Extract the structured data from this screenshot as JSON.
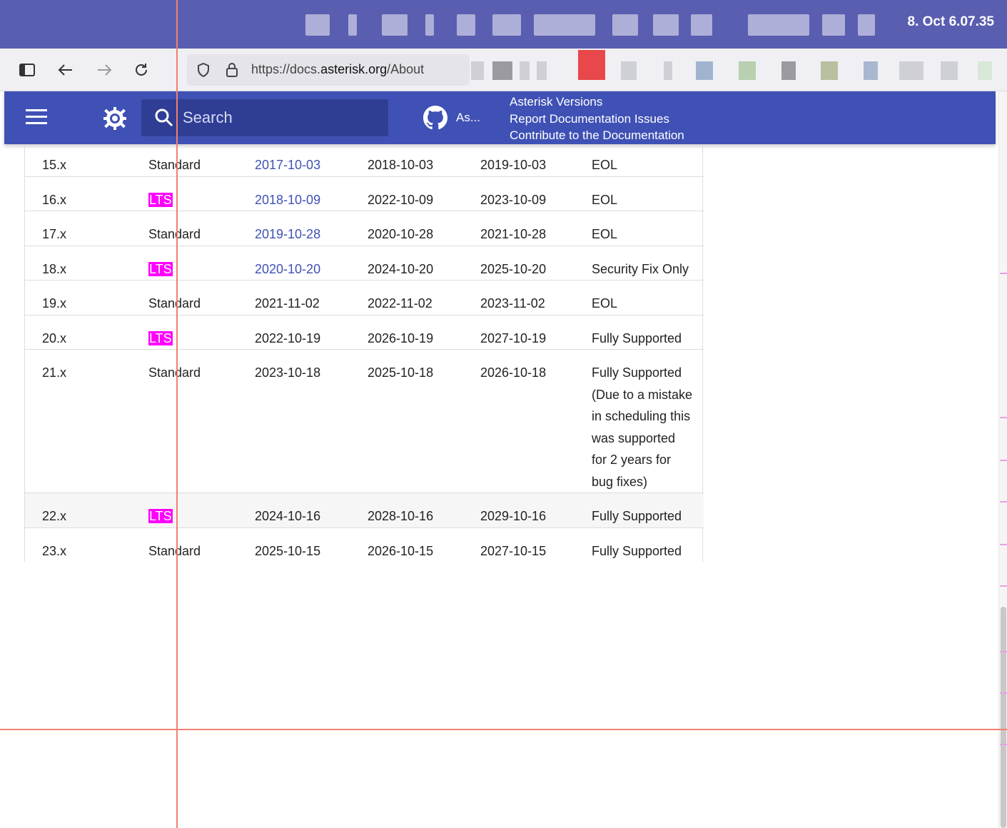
{
  "os": {
    "clock": "8. Oct 6.07.35"
  },
  "browser": {
    "url_prefix": "https://docs.",
    "url_domain": "asterisk.org",
    "url_path": "/About"
  },
  "header": {
    "search_placeholder": "Search",
    "github_label": "As...",
    "links": [
      "Asterisk Versions",
      "Report Documentation Issues",
      "Contribute to the Documentation"
    ]
  },
  "colors": {
    "header_bg": "#3f51b5",
    "link": "#3f51b5",
    "lts_badge": "#ff00ff",
    "os_bar": "#5a5eb0"
  },
  "versions": [
    {
      "release": "15.x",
      "type": "Standard",
      "date": "2017-10-03",
      "date_linked": true,
      "security": "2018-10-03",
      "eol": "2019-10-03",
      "status": "EOL"
    },
    {
      "release": "16.x",
      "type": "LTS",
      "date": "2018-10-09",
      "date_linked": true,
      "security": "2022-10-09",
      "eol": "2023-10-09",
      "status": "EOL"
    },
    {
      "release": "17.x",
      "type": "Standard",
      "date": "2019-10-28",
      "date_linked": true,
      "security": "2020-10-28",
      "eol": "2021-10-28",
      "status": "EOL"
    },
    {
      "release": "18.x",
      "type": "LTS",
      "date": "2020-10-20",
      "date_linked": true,
      "security": "2024-10-20",
      "eol": "2025-10-20",
      "status": "Security Fix Only"
    },
    {
      "release": "19.x",
      "type": "Standard",
      "date": "2021-11-02",
      "date_linked": false,
      "security": "2022-11-02",
      "eol": "2023-11-02",
      "status": "EOL"
    },
    {
      "release": "20.x",
      "type": "LTS",
      "date": "2022-10-19",
      "date_linked": false,
      "security": "2026-10-19",
      "eol": "2027-10-19",
      "status": "Fully Supported"
    },
    {
      "release": "21.x",
      "type": "Standard",
      "date": "2023-10-18",
      "date_linked": false,
      "security": "2025-10-18",
      "eol": "2026-10-18",
      "status": "Fully Supported (Due to a mistake in scheduling this was supported for 2 years for bug fixes)"
    },
    {
      "release": "22.x",
      "type": "LTS",
      "date": "2024-10-16",
      "date_linked": false,
      "security": "2028-10-16",
      "eol": "2029-10-16",
      "status": "Fully Supported"
    },
    {
      "release": "23.x",
      "type": "Standard",
      "date": "2025-10-15",
      "date_linked": false,
      "security": "2026-10-15",
      "eol": "2027-10-15",
      "status": "Fully Supported"
    }
  ]
}
